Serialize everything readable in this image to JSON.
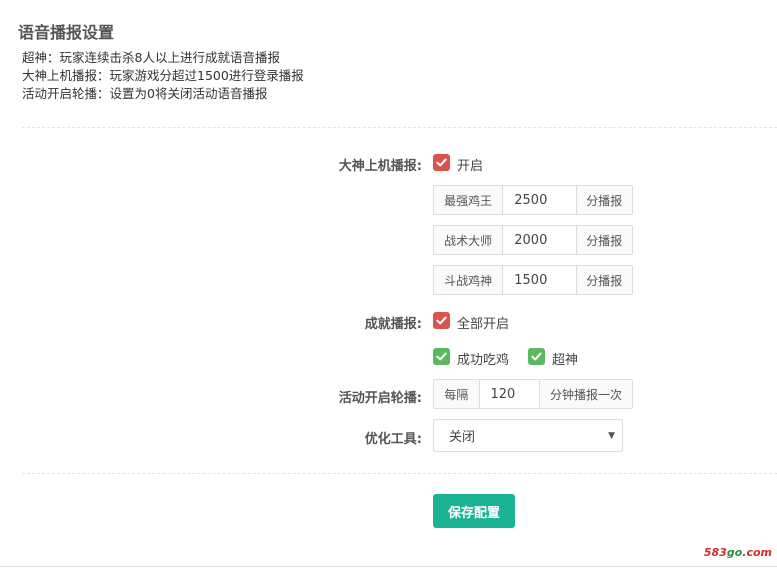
{
  "page": {
    "title": "语音播报设置"
  },
  "descriptions": [
    "超神：玩家连续击杀8人以上进行成就语音播报",
    "大神上机播报：玩家游戏分超过1500进行登录播报",
    "活动开启轮播：设置为0将关闭活动语音播报"
  ],
  "god_broadcast": {
    "label": "大神上机播报:",
    "checkbox_label": "开启",
    "checked": true,
    "rows": [
      {
        "prefix": "最强鸡王",
        "value": "2500",
        "suffix": "分播报"
      },
      {
        "prefix": "战术大师",
        "value": "2000",
        "suffix": "分播报"
      },
      {
        "prefix": "斗战鸡神",
        "value": "1500",
        "suffix": "分播报"
      }
    ]
  },
  "achievement": {
    "label": "成就播报:",
    "all_label": "全部开启",
    "all_checked": true,
    "options": [
      {
        "label": "成功吃鸡",
        "checked": true
      },
      {
        "label": "超神",
        "checked": true
      }
    ]
  },
  "carousel": {
    "label": "活动开启轮播:",
    "prefix": "每隔",
    "value": "120",
    "suffix": "分钟播报一次"
  },
  "optimize": {
    "label": "优化工具:",
    "selected": "关闭"
  },
  "save_button": "保存配置",
  "watermark": {
    "part1": "583",
    "part2": "go",
    "part3": ".com"
  },
  "colors": {
    "checkbox_red": "#d9534f",
    "checkbox_green": "#5cb85c",
    "button_green": "#1ab394"
  }
}
